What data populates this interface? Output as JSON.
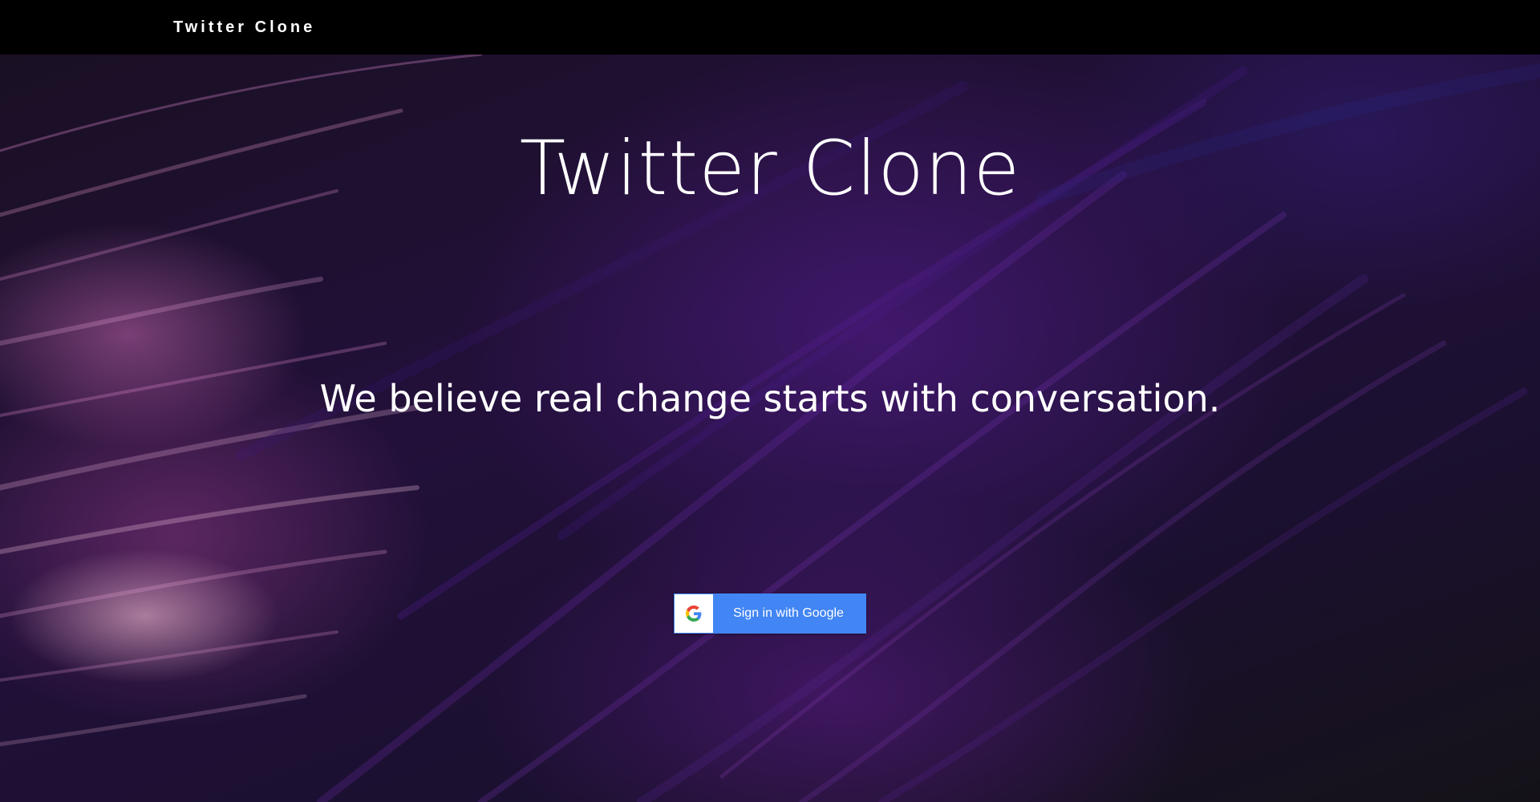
{
  "navbar": {
    "brand": "Twitter Clone"
  },
  "hero": {
    "title": "Twitter Clone",
    "tagline": "We believe real change starts with conversation."
  },
  "signin": {
    "label": "Sign in with Google",
    "icon": "google-g-icon",
    "button_color": "#4285f4"
  },
  "colors": {
    "navbar_bg": "#000000",
    "text": "#ffffff"
  }
}
